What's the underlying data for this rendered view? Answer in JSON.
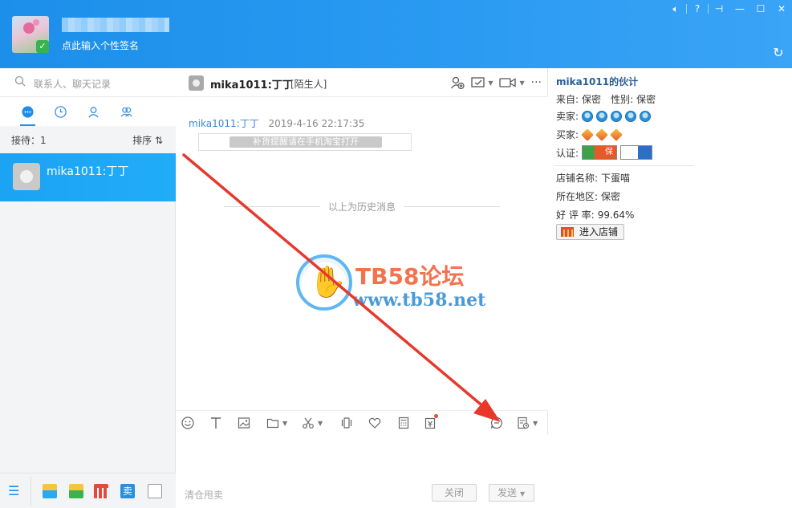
{
  "header": {
    "signature": "点此输入个性签名",
    "window_controls": [
      "volume-icon",
      "help-icon",
      "pin-icon",
      "minimize-icon",
      "maximize-icon",
      "close-icon"
    ]
  },
  "left": {
    "search_placeholder": "联系人、聊天记录",
    "tabs": [
      "chat-icon",
      "clock-icon",
      "person-icon",
      "group-icon"
    ],
    "waiting_label": "接待：1",
    "sort_label": "排序 ⇅",
    "chat_item_name": "mika1011:丁丁"
  },
  "chat": {
    "title": "mika1011:丁丁",
    "tag": "[陌生人]",
    "message": {
      "sender": "mika1011:丁丁",
      "time": "2019-4-16 22:17:35",
      "text": "补货提醒请在手机淘宝打开"
    },
    "history_label": "以上为历史消息",
    "watermark_title": "TB58论坛",
    "watermark_url": "www.tb58.net",
    "input_hint": "清仓甩卖",
    "close_label": "关闭",
    "send_label": "发送"
  },
  "info": {
    "title": "mika1011的伙计",
    "from_label": "来自:",
    "from_value": "保密",
    "gender_label": "性别:",
    "gender_value": "保密",
    "seller_label": "卖家:",
    "buyer_label": "买家:",
    "cert_label": "认证:",
    "cert_badge_text": "保",
    "shop_name_label": "店铺名称:",
    "shop_name_value": "下蛋喵",
    "region_label": "所在地区:",
    "region_value": "保密",
    "rating_label": "好 评 率:",
    "rating_value": "99.64%",
    "shop_button": "进入店铺"
  },
  "colors": {
    "header_blue": "#1c8fea",
    "selected_chat": "#1ba3f4",
    "arrow_red": "#e8382c"
  }
}
